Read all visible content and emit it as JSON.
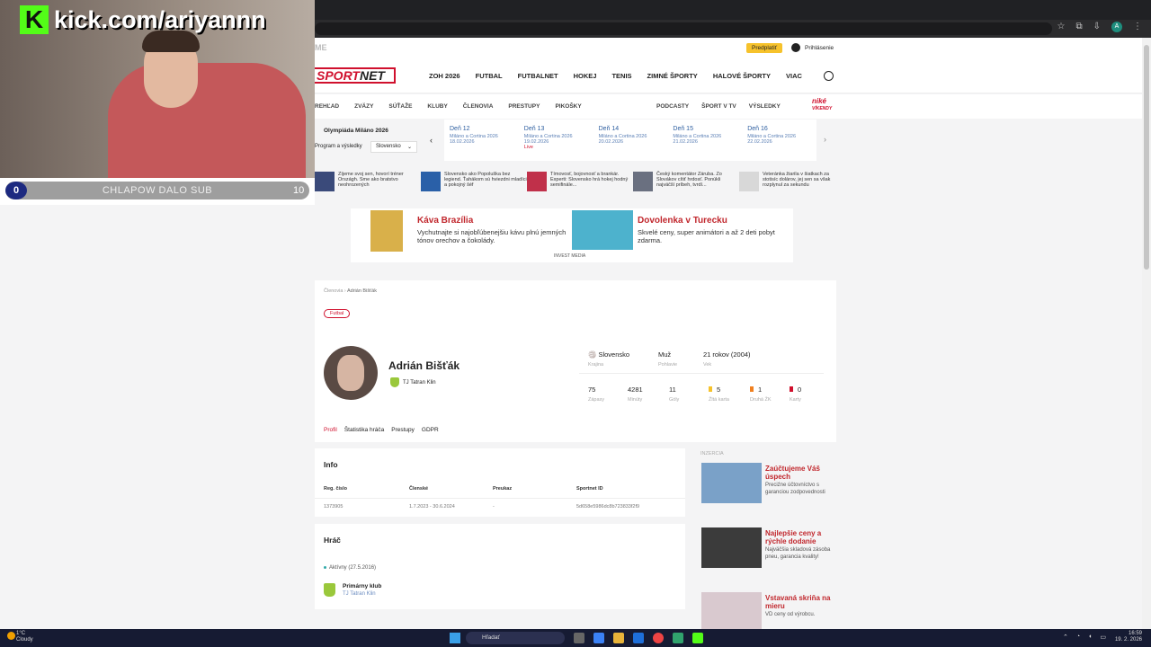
{
  "browser": {
    "account_initial": "A"
  },
  "stream": {
    "kick_logo": "K",
    "kick_url": "kick.com/ariyannn",
    "sub_counter_left": "0",
    "sub_message": "CHLAPOW DALO SUB",
    "sub_counter_right": "10"
  },
  "site": {
    "brand_tiny": "ME",
    "subscribe": "Predplatiť",
    "login": "Prihlásenie",
    "logo_a": "SPORT",
    "logo_b": "NET",
    "nav": [
      "ZOH 2026",
      "FUTBAL",
      "FUTBALNET",
      "HOKEJ",
      "TENIS",
      "ZIMNÉ ŠPORTY",
      "HALOVÉ ŠPORTY",
      "VIAC"
    ],
    "subnav": [
      "REHĽAD",
      "ZVÄZY",
      "SÚŤAŽE",
      "KLUBY",
      "ČLENOVIA",
      "PRESTUPY",
      "PIKOŠKY"
    ],
    "subnav_right": [
      "PODCASTY",
      "ŠPORT V TV",
      "VÝSLEDKY"
    ],
    "nike_a": "niké",
    "nike_b": "VÍKENDY"
  },
  "olympics": {
    "title": "Olympiáda Miláno 2026",
    "select1": "Program a výsledky",
    "select2": "Slovensko",
    "days": [
      {
        "day": "Deň 12",
        "place": "Miláno a Cortina 2026",
        "date": "18.02.2026",
        "live": ""
      },
      {
        "day": "Deň 13",
        "place": "Miláno a Cortina 2026",
        "date": "19.02.2026",
        "live": "Live"
      },
      {
        "day": "Deň 14",
        "place": "Miláno a Cortina 2026",
        "date": "20.02.2026",
        "live": ""
      },
      {
        "day": "Deň 15",
        "place": "Miláno a Cortina 2026",
        "date": "21.02.2026",
        "live": ""
      },
      {
        "day": "Deň 16",
        "place": "Miláno a Cortina 2026",
        "date": "22.02.2026",
        "live": ""
      }
    ]
  },
  "news": [
    {
      "text": "Zíjeme svoj sen, hovorí tréner Országh. Sme ako bratstvo neohrozených",
      "color": "#3a4a7a"
    },
    {
      "text": "Slovensko ako Popoluška bez legiend. Ťahákom sú hviezdni mladíci a pokojný šéf",
      "color": "#2a60a8"
    },
    {
      "text": "Tímovosť, bojovnosť a brankár. Experti: Slovensko hrá hokej hodný semifinále...",
      "color": "#c0304a"
    },
    {
      "text": "Český komentátor Záruba. Zo Slovákov cítiť hrdosť. Ponúkli najväčší príbeh, tvrdí...",
      "color": "#6a7080"
    },
    {
      "text": "Veteránka žiarila v šiatkach za stotisíc dolárov, jej sen sa však rozplynul za sekundu",
      "color": "#d8d8d8"
    }
  ],
  "ad": {
    "h1": "Káva Brazília",
    "t1": "Vychutnajte si najobľúbenejšiu kávu plnú jemných tónov orechov a čokolády.",
    "h2": "Dovolenka v Turecku",
    "t2": "Skvelé ceny, super animátori a až 2 deti pobyt zdarma.",
    "foot": "INVEST MEDIA"
  },
  "profile": {
    "crumb_a": "Členovia",
    "crumb_b": "Adrián Bišťák",
    "tag": "Futbal",
    "name": "Adrián Bišťák",
    "club": "TJ Tatran Klin",
    "country": "Slovensko",
    "country_label": "Krajina",
    "gender": "Muž",
    "gender_label": "Pohlavie",
    "age": "21 rokov (2004)",
    "age_label": "Vek",
    "stats": [
      {
        "val": "75",
        "lab": "Zápasy"
      },
      {
        "val": "4281",
        "lab": "Minúty"
      },
      {
        "val": "11",
        "lab": "Góly"
      },
      {
        "val": "5",
        "lab": "Žltá karta"
      },
      {
        "val": "1",
        "lab": "Druhá ŽK"
      },
      {
        "val": "0",
        "lab": "Karty"
      }
    ],
    "tabs": [
      "Profil",
      "Štatistika hráča",
      "Prestupy",
      "GDPR"
    ]
  },
  "info": {
    "title": "Info",
    "headers": [
      "Reg. číslo",
      "Členské",
      "Preukaz",
      "Sportnet ID"
    ],
    "values": [
      "1373905",
      "1.7.2023 - 30.6.2024",
      "-",
      "5d658e5986dc8b723833f2f9"
    ]
  },
  "hrac": {
    "title": "Hráč",
    "status": "Aktívny (27.5.2016)",
    "primary_label": "Primárny klub",
    "primary_club": "TJ Tatran Klin"
  },
  "sidebar": {
    "label": "INZERCIA",
    "items": [
      {
        "h": "Zaúčtujeme Váš úspech",
        "t": "Preciźne účtovníctvo s garanciou zodpovednosti"
      },
      {
        "h": "Najlepšie ceny a rýchle dodanie",
        "t": "Najväčšia skladová zásoba pneu, garancia kvality!"
      },
      {
        "h": "Vstavaná skriňa na mieru",
        "t": "VD ceny od výrobcu."
      }
    ]
  },
  "taskbar": {
    "temp": "1°C",
    "weather": "Cloudy",
    "search": "Hľadať",
    "time": "16:59",
    "date": "19. 2. 2026"
  }
}
